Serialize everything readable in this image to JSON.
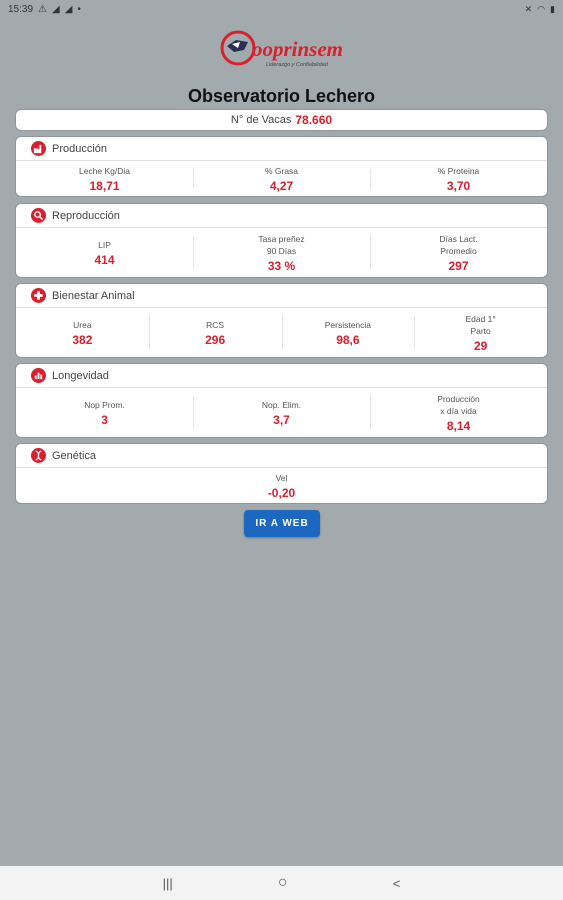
{
  "status": {
    "time": "15:39"
  },
  "brand": {
    "name": "Cooprinsem",
    "tagline": "Liderazgo y Confiabilidad"
  },
  "title": "Observatorio Lechero",
  "vacas": {
    "label": "N° de Vacas",
    "value": "78.660"
  },
  "sections": [
    {
      "title": "Producción",
      "icon": "factory-icon",
      "metrics": [
        {
          "label": "Leche Kg/Dia",
          "value": "18,71"
        },
        {
          "label": "% Grasa",
          "value": "4,27"
        },
        {
          "label": "% Proteina",
          "value": "3,70"
        }
      ]
    },
    {
      "title": "Reproducción",
      "icon": "search-icon",
      "metrics": [
        {
          "label": "LIP",
          "value": "414"
        },
        {
          "label": "Tasa preñez\n90 Días",
          "value": "33 %"
        },
        {
          "label": "Días Lact.\nPromedio",
          "value": "297"
        }
      ]
    },
    {
      "title": "Bienestar Animal",
      "icon": "medical-cross-icon",
      "metrics": [
        {
          "label": "Urea",
          "value": "382"
        },
        {
          "label": "RCS",
          "value": "296"
        },
        {
          "label": "Persistencia",
          "value": "98,6"
        },
        {
          "label": "Edad 1°\nParto",
          "value": "29"
        }
      ]
    },
    {
      "title": "Longevidad",
      "icon": "chart-icon",
      "metrics": [
        {
          "label": "Nop Prom.",
          "value": "3"
        },
        {
          "label": "Nop. Elim.",
          "value": "3,7"
        },
        {
          "label": "Producción\nx día vida",
          "value": "8,14"
        }
      ]
    },
    {
      "title": "Genética",
      "icon": "dna-icon",
      "metrics": [
        {
          "label": "Vel",
          "value": "-0,20"
        }
      ]
    }
  ],
  "button": {
    "label": "IR A WEB"
  },
  "navbar": {
    "recents": "|||",
    "home": "○",
    "back": "<"
  },
  "colors": {
    "accent": "#d8202e",
    "button": "#1c67c0",
    "background": "#a3aaae"
  }
}
